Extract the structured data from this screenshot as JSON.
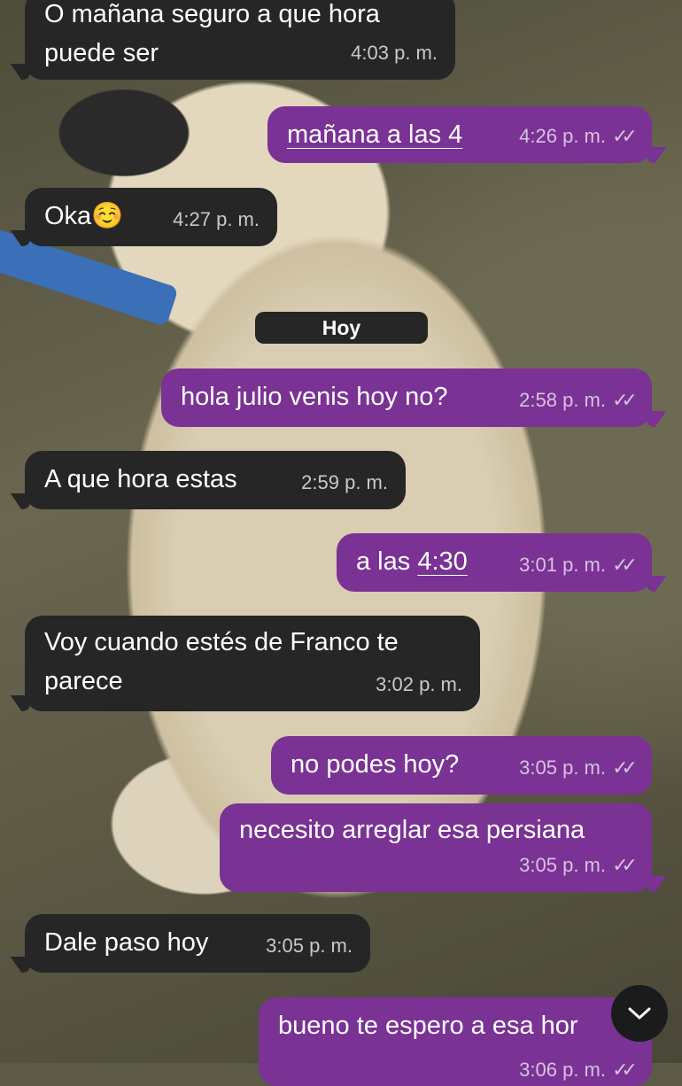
{
  "date_separator": "Hoy",
  "messages": [
    {
      "dir": "in",
      "line1": "O mañana seguro a que hora",
      "line2": "puede ser",
      "time": "4:03 p. m."
    },
    {
      "dir": "out",
      "text": "mañana a las 4",
      "time": "4:26 p. m.",
      "status": "read"
    },
    {
      "dir": "in",
      "text": "Oka☺️",
      "time": "4:27 p. m."
    },
    {
      "dir": "out",
      "text": "hola julio venis hoy no?",
      "time": "2:58 p. m.",
      "status": "read"
    },
    {
      "dir": "in",
      "text": "A que hora estas",
      "time": "2:59 p. m."
    },
    {
      "dir": "out",
      "prefix": "a las ",
      "link": "4:30",
      "time": "3:01 p. m.",
      "status": "read"
    },
    {
      "dir": "in",
      "line1": "Voy cuando estés de Franco te",
      "line2": "parece",
      "time": "3:02 p. m."
    },
    {
      "dir": "out",
      "text": "no podes hoy?",
      "time": "3:05 p. m.",
      "status": "read"
    },
    {
      "dir": "out",
      "text": "necesito arreglar esa persiana",
      "time": "3:05 p. m.",
      "status": "read"
    },
    {
      "dir": "in",
      "text": "Dale paso hoy",
      "time": "3:05 p. m."
    },
    {
      "dir": "out",
      "text": "bueno te espero a esa hor",
      "time": "3:06 p. m.",
      "status": "read"
    }
  ],
  "check_glyph": "✓✓",
  "icons": {
    "scroll_down": "chevron-down-icon"
  },
  "colors": {
    "incoming": "#262626",
    "outgoing": "#7a3294"
  }
}
